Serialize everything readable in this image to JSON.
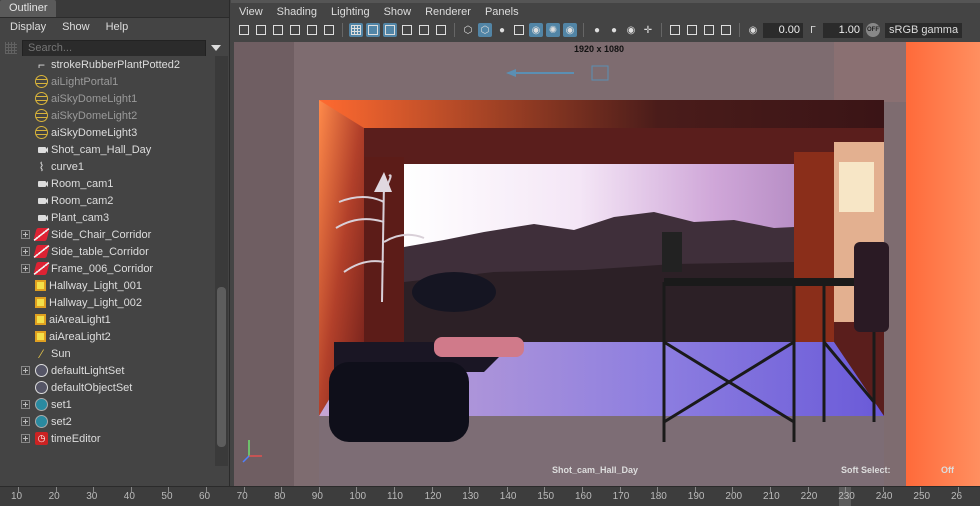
{
  "outliner": {
    "tab_title": "Outliner",
    "menu": [
      "Display",
      "Show",
      "Help"
    ],
    "search_placeholder": "Search...",
    "items": [
      {
        "label": "strokeRubberPlantPotted2",
        "icon": "stroke-icon",
        "expandable": false,
        "dim": false
      },
      {
        "label": "aiLightPortal1",
        "icon": "light-portal-icon",
        "expandable": false,
        "dim": true
      },
      {
        "label": "aiSkyDomeLight1",
        "icon": "skydome-icon",
        "expandable": false,
        "dim": true
      },
      {
        "label": "aiSkyDomeLight2",
        "icon": "skydome-icon",
        "expandable": false,
        "dim": true
      },
      {
        "label": "aiSkyDomeLight3",
        "icon": "skydome-icon",
        "expandable": false,
        "dim": false
      },
      {
        "label": "Shot_cam_Hall_Day",
        "icon": "camera-icon",
        "expandable": false,
        "dim": false
      },
      {
        "label": "curve1",
        "icon": "curve-icon",
        "expandable": false,
        "dim": false
      },
      {
        "label": "Room_cam1",
        "icon": "camera-icon",
        "expandable": false,
        "dim": false
      },
      {
        "label": "Room_cam2",
        "icon": "camera-icon",
        "expandable": false,
        "dim": false
      },
      {
        "label": "Plant_cam3",
        "icon": "camera-icon",
        "expandable": false,
        "dim": false
      },
      {
        "label": "Side_Chair_Corridor",
        "icon": "mesh-icon",
        "expandable": true,
        "dim": false
      },
      {
        "label": "Side_table_Corridor",
        "icon": "mesh-icon",
        "expandable": true,
        "dim": false
      },
      {
        "label": "Frame_006_Corridor",
        "icon": "mesh-icon",
        "expandable": true,
        "dim": false
      },
      {
        "label": "Hallway_Light_001",
        "icon": "area-light-icon",
        "expandable": false,
        "dim": false
      },
      {
        "label": "Hallway_Light_002",
        "icon": "area-light-icon",
        "expandable": false,
        "dim": false
      },
      {
        "label": "aiAreaLight1",
        "icon": "area-light-icon",
        "expandable": false,
        "dim": false
      },
      {
        "label": "aiAreaLight2",
        "icon": "area-light-icon",
        "expandable": false,
        "dim": false
      },
      {
        "label": "Sun",
        "icon": "sun-icon",
        "expandable": false,
        "dim": false
      },
      {
        "label": "defaultLightSet",
        "icon": "set-icon",
        "expandable": true,
        "dim": false
      },
      {
        "label": "defaultObjectSet",
        "icon": "set-icon",
        "expandable": false,
        "dim": false
      },
      {
        "label": "set1",
        "icon": "set-color-icon",
        "expandable": true,
        "dim": false
      },
      {
        "label": "set2",
        "icon": "set-color-icon",
        "expandable": true,
        "dim": false
      },
      {
        "label": "timeEditor",
        "icon": "time-editor-icon",
        "expandable": true,
        "dim": false
      }
    ],
    "scroll_position": 0.56
  },
  "viewport": {
    "menu": [
      "View",
      "Shading",
      "Lighting",
      "Show",
      "Renderer",
      "Panels"
    ],
    "exposure_value": "0.00",
    "gamma_value": "1.00",
    "color_space": "sRGB gamma",
    "gamma_badge": "OFF",
    "resolution_gate": "1920 x 1080",
    "camera_name": "Shot_cam_Hall_Day",
    "soft_select_label": "Soft Select:",
    "soft_select_value": "Off"
  },
  "timeline": {
    "ticks": [
      "10",
      "20",
      "30",
      "40",
      "50",
      "60",
      "70",
      "80",
      "90",
      "100",
      "110",
      "120",
      "130",
      "140",
      "150",
      "160",
      "170",
      "180",
      "190",
      "200",
      "210",
      "220",
      "230",
      "240",
      "250",
      "26"
    ],
    "current_frame": "230"
  },
  "colors": {
    "panel_bg": "#444444",
    "selection_blue": "#5285a6",
    "area_light_yellow": "#f3e04a"
  }
}
